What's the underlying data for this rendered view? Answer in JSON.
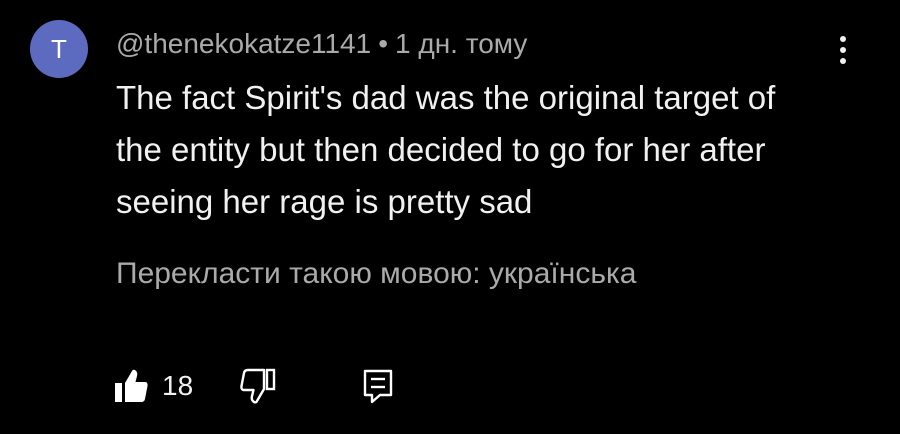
{
  "comment": {
    "avatar_letter": "T",
    "avatar_color": "#5c6bc0",
    "author": "@thenekokatze1141",
    "separator": "•",
    "time": "1 дн. тому",
    "text": "The fact Spirit's dad was the original target of the entity but then decided to go for her after seeing her rage is pretty sad",
    "translate_label": "Перекласти такою мовою: українська",
    "like_count": "18"
  },
  "icons": {
    "menu": "vertical-dots-icon",
    "like": "thumb-up-icon",
    "dislike": "thumb-down-icon",
    "reply": "comment-reply-icon"
  },
  "colors": {
    "background": "#000000",
    "text_primary": "#f1f1f1",
    "text_secondary": "#aaaaaa"
  }
}
